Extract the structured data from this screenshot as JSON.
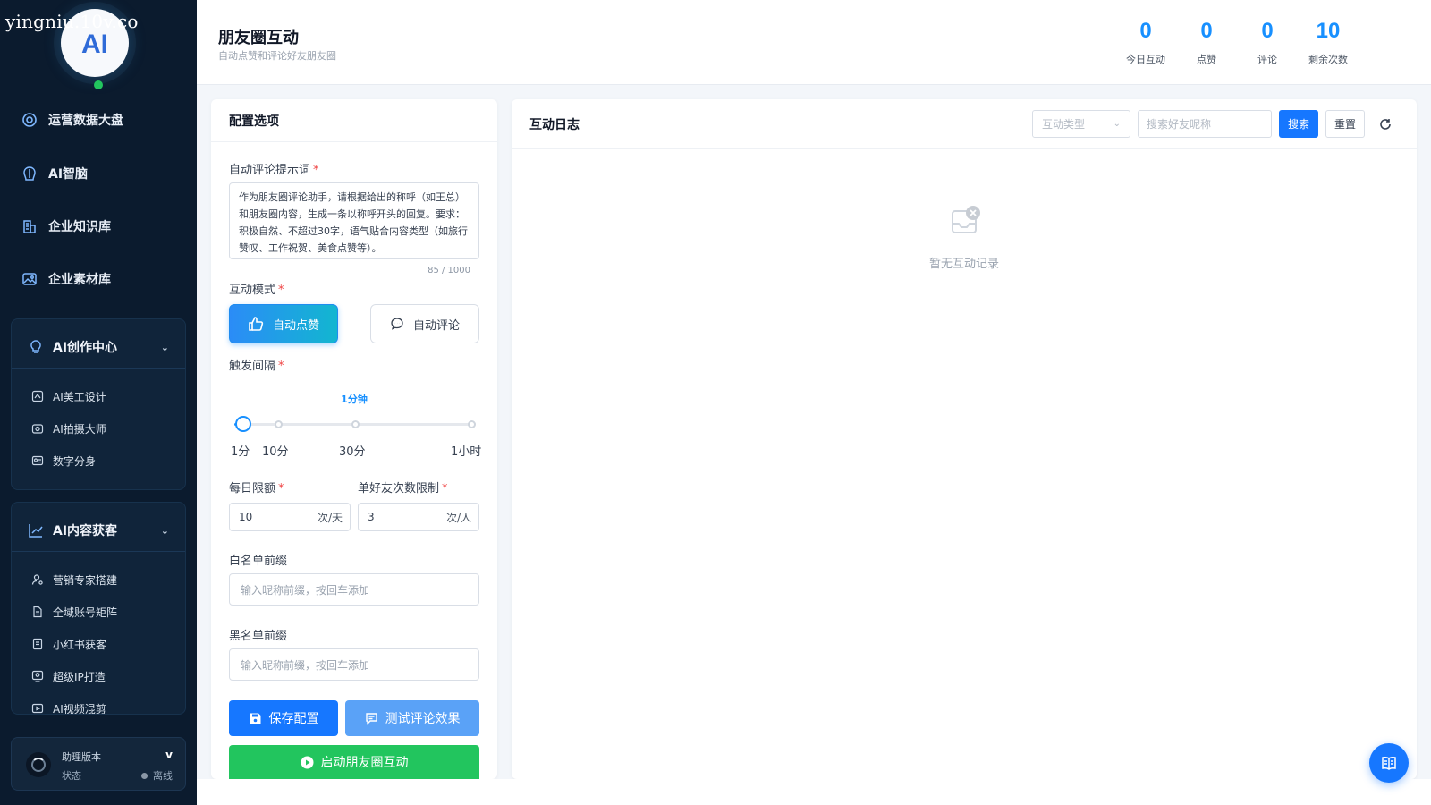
{
  "watermark": "yingniu.10v.co",
  "logo": {
    "text": "AI"
  },
  "nav": [
    {
      "label": "运营数据大盘",
      "icon": "dashboard-icon"
    },
    {
      "label": "AI智脑",
      "icon": "brain-icon"
    },
    {
      "label": "企业知识库",
      "icon": "building-icon"
    },
    {
      "label": "企业素材库",
      "icon": "image-icon"
    }
  ],
  "groups": {
    "creation": {
      "title": "AI创作中心",
      "items": [
        "AI美工设计",
        "AI拍摄大师",
        "数字分身"
      ]
    },
    "acquisition": {
      "title": "AI内容获客",
      "items": [
        "营销专家搭建",
        "全域账号矩阵",
        "小红书获客",
        "超级IP打造",
        "AI视频混剪"
      ]
    }
  },
  "status_card": {
    "version_label": "助理版本",
    "version_value": "v",
    "status_label": "状态",
    "status_value": "离线"
  },
  "header": {
    "title": "朋友圈互动",
    "subtitle": "自动点赞和评论好友朋友圈",
    "stats": [
      {
        "value": "0",
        "label": "今日互动"
      },
      {
        "value": "0",
        "label": "点赞"
      },
      {
        "value": "0",
        "label": "评论"
      },
      {
        "value": "10",
        "label": "剩余次数"
      }
    ]
  },
  "config": {
    "title": "配置选项",
    "prompt_label": "自动评论提示词",
    "prompt_value": "作为朋友圈评论助手，请根据给出的称呼（如王总）和朋友圈内容，生成一条以称呼开头的回复。要求：积极自然、不超过30字，语气贴合内容类型（如旅行赞叹、工作祝贺、美食点赞等）。",
    "prompt_counter": "85 / 1000",
    "mode_label": "互动模式",
    "mode_like": "自动点赞",
    "mode_comment": "自动评论",
    "interval_label": "触发间隔",
    "interval_value": "1分钟",
    "interval_level": 0,
    "ticks": [
      "1分",
      "10分",
      "30分",
      "1小时"
    ],
    "daily_limit_label": "每日限额",
    "daily_limit_value": "10",
    "daily_limit_unit": "次/天",
    "friend_limit_label": "单好友次数限制",
    "friend_limit_value": "3",
    "friend_limit_unit": "次/人",
    "whitelist_label": "白名单前缀",
    "whitelist_placeholder": "输入昵称前缀，按回车添加",
    "blacklist_label": "黑名单前缀",
    "blacklist_placeholder": "输入昵称前缀，按回车添加",
    "save_label": "保存配置",
    "test_label": "测试评论效果",
    "start_label": "启动朋友圈互动"
  },
  "log": {
    "title": "互动日志",
    "type_placeholder": "互动类型",
    "search_placeholder": "搜索好友昵称",
    "search_label": "搜索",
    "reset_label": "重置",
    "empty_text": "暂无互动记录"
  },
  "colors": {
    "primary": "#1677ff",
    "success": "#22c55e",
    "sidebar_bg": "#0b1b2e",
    "stat_blue": "#1890ff"
  }
}
